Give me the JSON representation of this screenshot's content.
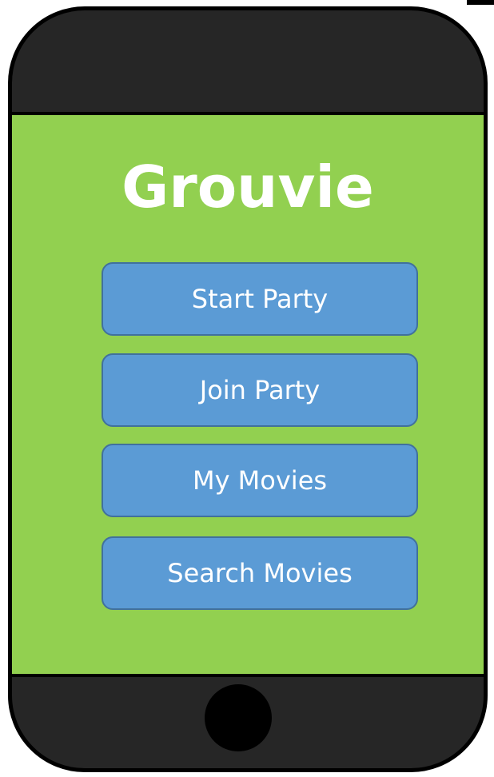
{
  "app": {
    "title": "Grouvie"
  },
  "menu": {
    "start_party": "Start Party",
    "join_party": "Join Party",
    "my_movies": "My Movies",
    "search_movies": "Search Movies"
  },
  "colors": {
    "screen_background": "#92d050",
    "button_fill": "#5b9bd5",
    "button_border": "#41719c",
    "phone_body": "#262626",
    "text": "#ffffff"
  }
}
